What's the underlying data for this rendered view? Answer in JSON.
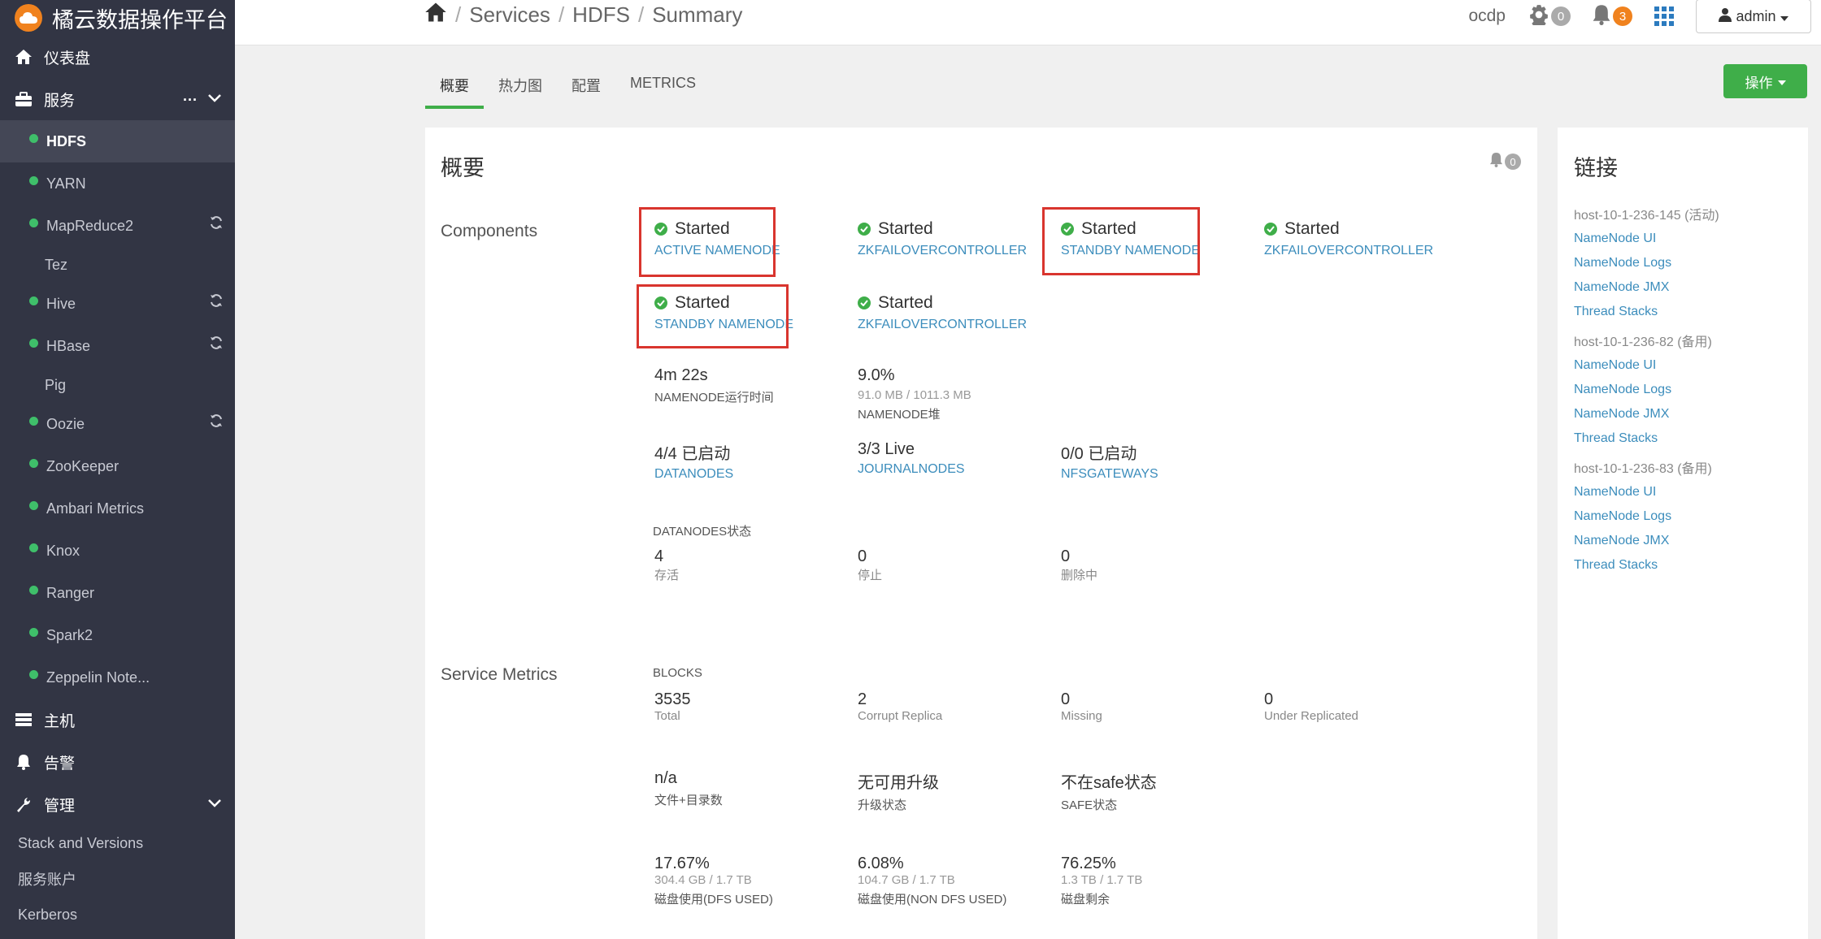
{
  "brand": {
    "title": "橘云数据操作平台"
  },
  "sidebar": {
    "dashboard": "仪表盘",
    "services": "服务",
    "services_more": "...",
    "service_items": [
      {
        "label": "HDFS",
        "dot": true,
        "active": true,
        "refresh": false
      },
      {
        "label": "YARN",
        "dot": true,
        "active": false,
        "refresh": false
      },
      {
        "label": "MapReduce2",
        "dot": true,
        "active": false,
        "refresh": true
      },
      {
        "label": "Tez",
        "dot": false,
        "active": false,
        "refresh": false
      },
      {
        "label": "Hive",
        "dot": true,
        "active": false,
        "refresh": true
      },
      {
        "label": "HBase",
        "dot": true,
        "active": false,
        "refresh": true
      },
      {
        "label": "Pig",
        "dot": false,
        "active": false,
        "refresh": false
      },
      {
        "label": "Oozie",
        "dot": true,
        "active": false,
        "refresh": true
      },
      {
        "label": "ZooKeeper",
        "dot": true,
        "active": false,
        "refresh": false
      },
      {
        "label": "Ambari Metrics",
        "dot": true,
        "active": false,
        "refresh": false
      },
      {
        "label": "Knox",
        "dot": true,
        "active": false,
        "refresh": false
      },
      {
        "label": "Ranger",
        "dot": true,
        "active": false,
        "refresh": false
      },
      {
        "label": "Spark2",
        "dot": true,
        "active": false,
        "refresh": false
      },
      {
        "label": "Zeppelin Note...",
        "dot": true,
        "active": false,
        "refresh": false
      }
    ],
    "hosts": "主机",
    "alerts": "告警",
    "admin": "管理",
    "admin_items": [
      "Stack and Versions",
      "服务账户",
      "Kerberos"
    ]
  },
  "topbar": {
    "breadcrumb": [
      "Services",
      "HDFS",
      "Summary"
    ],
    "cluster": "ocdp",
    "ops_count": "0",
    "alert_count": "3",
    "user": "admin"
  },
  "tabs": [
    "概要",
    "热力图",
    "配置",
    "METRICS"
  ],
  "action_button": "操作",
  "summary": {
    "title": "概要",
    "bell_count": "0",
    "components_label": "Components",
    "components": [
      {
        "status": "Started",
        "name": "ACTIVE NAMENODE"
      },
      {
        "status": "Started",
        "name": "ZKFAILOVERCONTROLLER"
      },
      {
        "status": "Started",
        "name": "STANDBY NAMENODE"
      },
      {
        "status": "Started",
        "name": "ZKFAILOVERCONTROLLER"
      },
      {
        "status": "Started",
        "name": "STANDBY NAMENODE"
      },
      {
        "status": "Started",
        "name": "ZKFAILOVERCONTROLLER"
      }
    ],
    "uptime": {
      "value": "4m 22s",
      "label": "NAMENODE运行时间"
    },
    "heap": {
      "value": "9.0%",
      "detail": "91.0 MB / 1011.3 MB",
      "label": "NAMENODE堆"
    },
    "datanodes": {
      "value": "4/4 已启动",
      "label": "DATANODES"
    },
    "journalnodes": {
      "value": "3/3 Live",
      "label": "JOURNALNODES"
    },
    "nfsgateways": {
      "value": "0/0 已启动",
      "label": "NFSGATEWAYS"
    },
    "dn_status_header": "DATANODES状态",
    "dn_status": [
      {
        "value": "4",
        "label": "存活"
      },
      {
        "value": "0",
        "label": "停止"
      },
      {
        "value": "0",
        "label": "删除中"
      }
    ],
    "metrics_label": "Service Metrics",
    "blocks_header": "BLOCKS",
    "blocks": [
      {
        "value": "3535",
        "label": "Total"
      },
      {
        "value": "2",
        "label": "Corrupt Replica"
      },
      {
        "value": "0",
        "label": "Missing"
      },
      {
        "value": "0",
        "label": "Under Replicated"
      }
    ],
    "misc": [
      {
        "value": "n/a",
        "label": "文件+目录数"
      },
      {
        "value": "无可用升级",
        "label": "升级状态"
      },
      {
        "value": "不在safe状态",
        "label": "SAFE状态"
      }
    ],
    "disk": [
      {
        "value": "17.67%",
        "detail": "304.4 GB / 1.7 TB",
        "label": "磁盘使用(DFS USED)"
      },
      {
        "value": "6.08%",
        "detail": "104.7 GB / 1.7 TB",
        "label": "磁盘使用(NON DFS USED)"
      },
      {
        "value": "76.25%",
        "detail": "1.3 TB / 1.7 TB",
        "label": "磁盘剩余"
      }
    ]
  },
  "links": {
    "title": "链接",
    "groups": [
      {
        "host": "host-10-1-236-145 (活动)",
        "items": [
          "NameNode UI",
          "NameNode Logs",
          "NameNode JMX",
          "Thread Stacks"
        ]
      },
      {
        "host": "host-10-1-236-82 (备用)",
        "items": [
          "NameNode UI",
          "NameNode Logs",
          "NameNode JMX",
          "Thread Stacks"
        ]
      },
      {
        "host": "host-10-1-236-83 (备用)",
        "items": [
          "NameNode UI",
          "NameNode Logs",
          "NameNode JMX",
          "Thread Stacks"
        ]
      }
    ]
  }
}
